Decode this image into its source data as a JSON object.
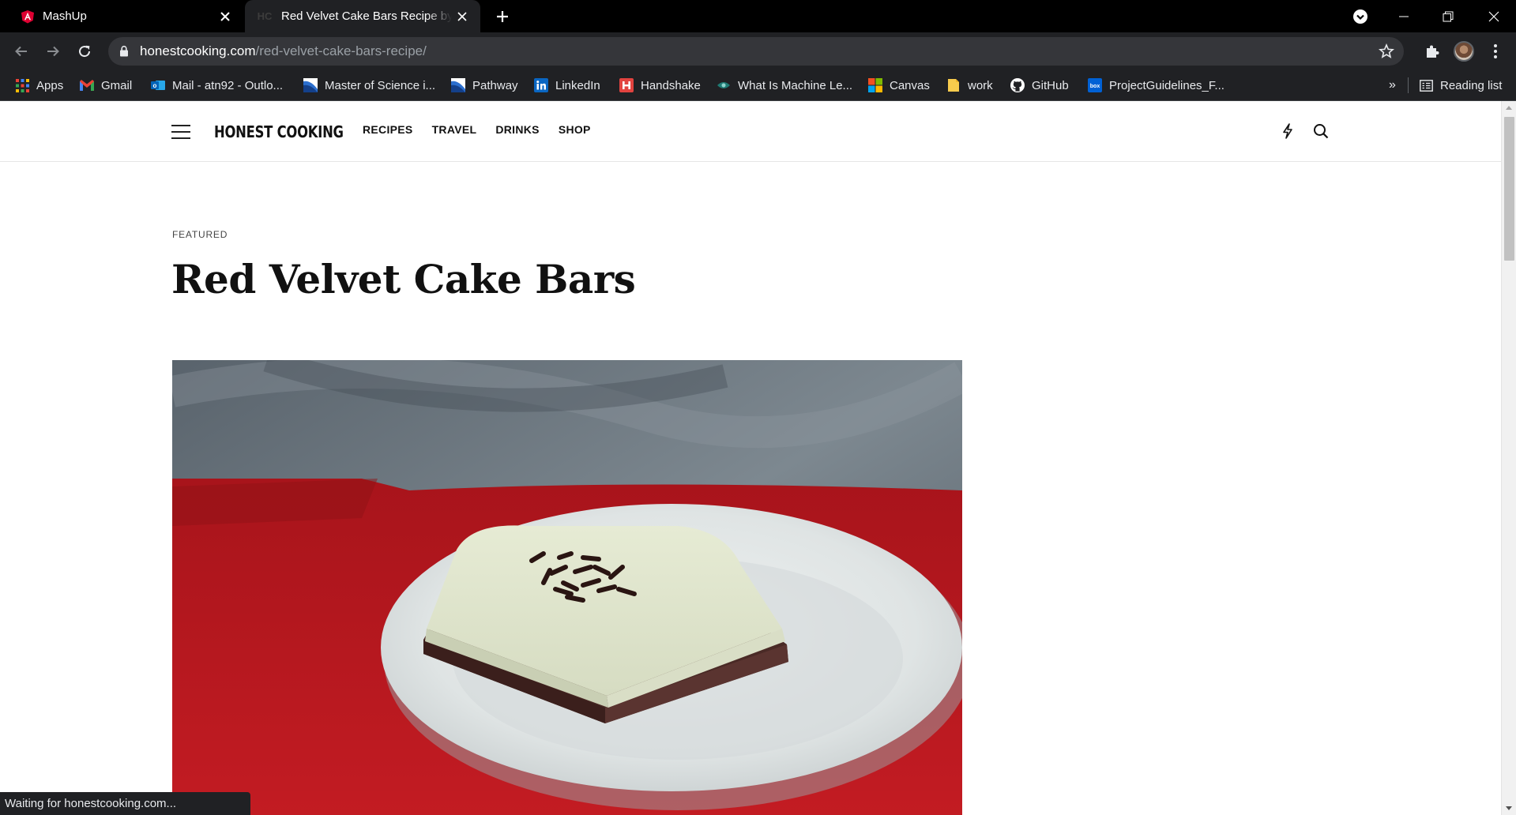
{
  "browser": {
    "tabs": [
      {
        "title": "MashUp",
        "favicon": "angular-icon",
        "active": false
      },
      {
        "title": "Red Velvet Cake Bars Recipe by A",
        "favicon_text": "HC",
        "active": true
      }
    ],
    "address": {
      "domain": "honestcooking.com",
      "path": "/red-velvet-cake-bars-recipe/"
    },
    "bookmarks": [
      {
        "label": "Apps",
        "icon": "apps-grid-icon"
      },
      {
        "label": "Gmail",
        "icon": "gmail-icon"
      },
      {
        "label": "Mail - atn92 - Outlo...",
        "icon": "outlook-icon"
      },
      {
        "label": "Master of Science i...",
        "icon": "generic-site-icon"
      },
      {
        "label": "Pathway",
        "icon": "generic-site-icon"
      },
      {
        "label": "LinkedIn",
        "icon": "linkedin-icon"
      },
      {
        "label": "Handshake",
        "icon": "handshake-icon"
      },
      {
        "label": "What Is Machine Le...",
        "icon": "eye-icon"
      },
      {
        "label": "Canvas",
        "icon": "microsoft-icon"
      },
      {
        "label": "work",
        "icon": "folder-icon"
      },
      {
        "label": "GitHub",
        "icon": "github-icon"
      },
      {
        "label": "ProjectGuidelines_F...",
        "icon": "box-icon"
      }
    ],
    "overflow_label": "»",
    "reading_list_label": "Reading list",
    "status_text": "Waiting for honestcooking.com..."
  },
  "site": {
    "logo": "HONEST COOKING",
    "nav": [
      "RECIPES",
      "TRAVEL",
      "DRINKS",
      "SHOP"
    ]
  },
  "article": {
    "kicker": "FEATURED",
    "title": "Red Velvet Cake Bars"
  },
  "colors": {
    "chrome_dark": "#202124",
    "tab_strip": "#000000",
    "angular_red": "#dd0031",
    "plate_cloth_red": "#c0161e"
  }
}
